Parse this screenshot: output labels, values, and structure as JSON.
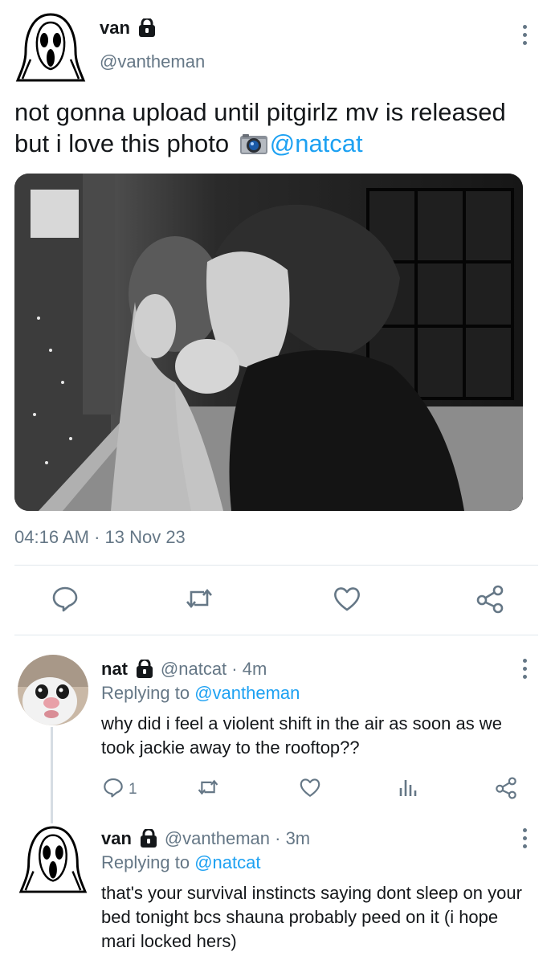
{
  "main_tweet": {
    "name": "van",
    "handle": "@vantheman",
    "text_line1": "not gonna upload until pitgirlz mv is released",
    "text_line2": "but i love this photo ",
    "mention": "@natcat",
    "timestamp": "04:16 AM · 13 Nov 23"
  },
  "replies": [
    {
      "name": "nat",
      "meta": "@natcat · 4m",
      "replying_prefix": "Replying to ",
      "replying_to": "@vantheman",
      "body": "why did i feel a violent shift in the air as soon as we took jackie away to the rooftop??",
      "reply_count": "1"
    },
    {
      "name": "van",
      "meta": "@vantheman · 3m",
      "replying_prefix": "Replying to ",
      "replying_to": "@natcat",
      "body": "that's your survival instincts saying dont sleep on your bed tonight bcs shauna probably peed on it (i hope mari locked hers)"
    }
  ],
  "icons": {
    "lock": "lock-icon",
    "more": "more-vertical-icon",
    "reply": "reply-icon",
    "retweet": "retweet-icon",
    "like": "heart-icon",
    "share": "share-icon",
    "analytics": "analytics-icon",
    "camera": "camera-emoji"
  },
  "colors": {
    "accent": "#1da1f2",
    "muted": "#657786",
    "text": "#14171a",
    "divider": "#e1e8ed"
  }
}
